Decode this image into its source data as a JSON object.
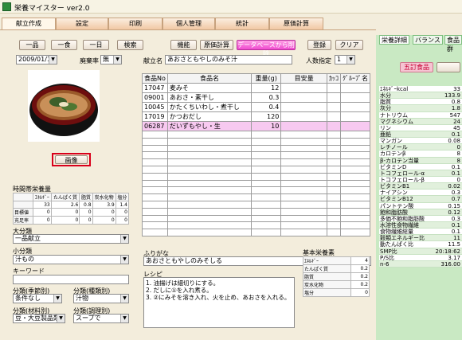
{
  "window": {
    "title": "栄養マイスター ver2.0"
  },
  "main_tabs": [
    "献立作成",
    "設定",
    "印刷",
    "個人管理",
    "統計",
    "原価計算"
  ],
  "toolbar": {
    "ichihin": "一品",
    "isshoku": "一食",
    "ichinichi": "一日",
    "search": "検索",
    "kinou": "機能",
    "genka": "原価計算",
    "db_delete": "データベースから削除",
    "register": "登録",
    "clear": "クリア"
  },
  "date": "2009/01/14",
  "haikiritsu": {
    "label": "廃棄率",
    "value": "無"
  },
  "menu": {
    "name_label": "献立名",
    "name": "あおさともやしのみそ汁",
    "people_label": "人数指定",
    "people": "1"
  },
  "image_button": "画像",
  "food_table": {
    "headers": [
      "食品No",
      "食品名",
      "重量(g)",
      "目安量",
      "ｶｯｺ",
      "ｸﾞﾙｰﾌﾟ名"
    ],
    "rows": [
      {
        "no": "17047",
        "name": "麦みそ",
        "weight": "12"
      },
      {
        "no": "09001",
        "name": "あおさ・素干し",
        "weight": "0.3"
      },
      {
        "no": "10045",
        "name": "かたくちいわし・煮干し",
        "weight": "0.4"
      },
      {
        "no": "17019",
        "name": "かつおだし",
        "weight": "120"
      },
      {
        "no": "06287",
        "name": "だいずもやし・生",
        "weight": "10"
      }
    ]
  },
  "period": {
    "title": "時間帯栄養量",
    "headers": [
      "ｴﾈﾙｷﾞｰ",
      "たんぱく質",
      "脂質",
      "炭水化物",
      "塩分"
    ],
    "values": [
      "33",
      "2.6",
      "0.8",
      "3.9",
      "1.4"
    ],
    "rows": [
      {
        "label": "目標値",
        "values": [
          "0",
          "0",
          "0",
          "0",
          "0"
        ]
      },
      {
        "label": "充足率",
        "values": [
          "0",
          "0",
          "0",
          "0",
          "0"
        ]
      }
    ]
  },
  "categories": {
    "large": {
      "label": "大分類",
      "value": "一品献立"
    },
    "small": {
      "label": "小分類",
      "value": "汁もの"
    },
    "keyword": {
      "label": "キーワード",
      "value": ""
    },
    "season": {
      "label": "分類(季節別)",
      "value": "条件なし"
    },
    "type": {
      "label": "分類(種類別)",
      "value": "汁物"
    },
    "material": {
      "label": "分類(材料別)",
      "value": "豆・大豆製品類"
    },
    "cooking": {
      "label": "分類(調理別)",
      "value": "スープで"
    }
  },
  "furigana": {
    "label": "ふりがな",
    "value": "あおさともやしのみそしる"
  },
  "recipe": {
    "label": "レシピ",
    "lines": [
      "1. 油揚げは細切りにする。",
      "2. だしに①を入れ煮る。",
      "3. ②にみそを溶き入れ、火を止め、あおさを入れる。"
    ]
  },
  "basic": {
    "label": "基本栄養素",
    "rows": [
      {
        "name": "ｴﾈﾙｷﾞｰ",
        "value": "4"
      },
      {
        "name": "たんぱく質",
        "value": "0.2"
      },
      {
        "name": "脂質",
        "value": "0.2"
      },
      {
        "name": "炭水化物",
        "value": "0.2"
      },
      {
        "name": "塩分",
        "value": "0"
      }
    ]
  },
  "right": {
    "tabs": [
      "栄養詳細",
      "バランス",
      "食品群"
    ],
    "goten": "五訂食品",
    "nutrients": [
      {
        "name": "ｴﾈﾙｷﾞｰkcal",
        "value": "33"
      },
      {
        "name": "水分",
        "value": "133.9"
      },
      {
        "name": "脂質",
        "value": "0.8"
      },
      {
        "name": "灰分",
        "value": "1.8"
      },
      {
        "name": "ナトリウム",
        "value": "547"
      },
      {
        "name": "マグネシウム",
        "value": "24"
      },
      {
        "name": "リン",
        "value": "45"
      },
      {
        "name": "亜鉛",
        "value": "0.1"
      },
      {
        "name": "マンガン",
        "value": "0.08"
      },
      {
        "name": "レチノール",
        "value": "0"
      },
      {
        "name": "カロテンβ",
        "value": "8"
      },
      {
        "name": "β-カロテン当量",
        "value": "8"
      },
      {
        "name": "ビタミンD",
        "value": "0.1"
      },
      {
        "name": "トコフェロール-α",
        "value": "0.1"
      },
      {
        "name": "トコフェロール-β",
        "value": "0"
      },
      {
        "name": "ビタミンB1",
        "value": "0.02"
      },
      {
        "name": "ナイアシン",
        "value": "0.3"
      },
      {
        "name": "ビタミンB12",
        "value": "0.7"
      },
      {
        "name": "パントテン酸",
        "value": "0.15"
      },
      {
        "name": "飽和脂肪酸",
        "value": "0.12"
      },
      {
        "name": "多価不飽和脂肪酸",
        "value": "0.3"
      },
      {
        "name": "水溶性食物繊維",
        "value": "0.1"
      },
      {
        "name": "食物繊維総量",
        "value": "0.1"
      },
      {
        "name": "穀類エネルギー比",
        "value": "11"
      },
      {
        "name": "動たんぱく比",
        "value": "11.5"
      },
      {
        "name": "SMP比",
        "value": "20:18:62"
      },
      {
        "name": "P/S比",
        "value": "3.17"
      },
      {
        "name": "n-6",
        "value": "316.00"
      }
    ]
  }
}
